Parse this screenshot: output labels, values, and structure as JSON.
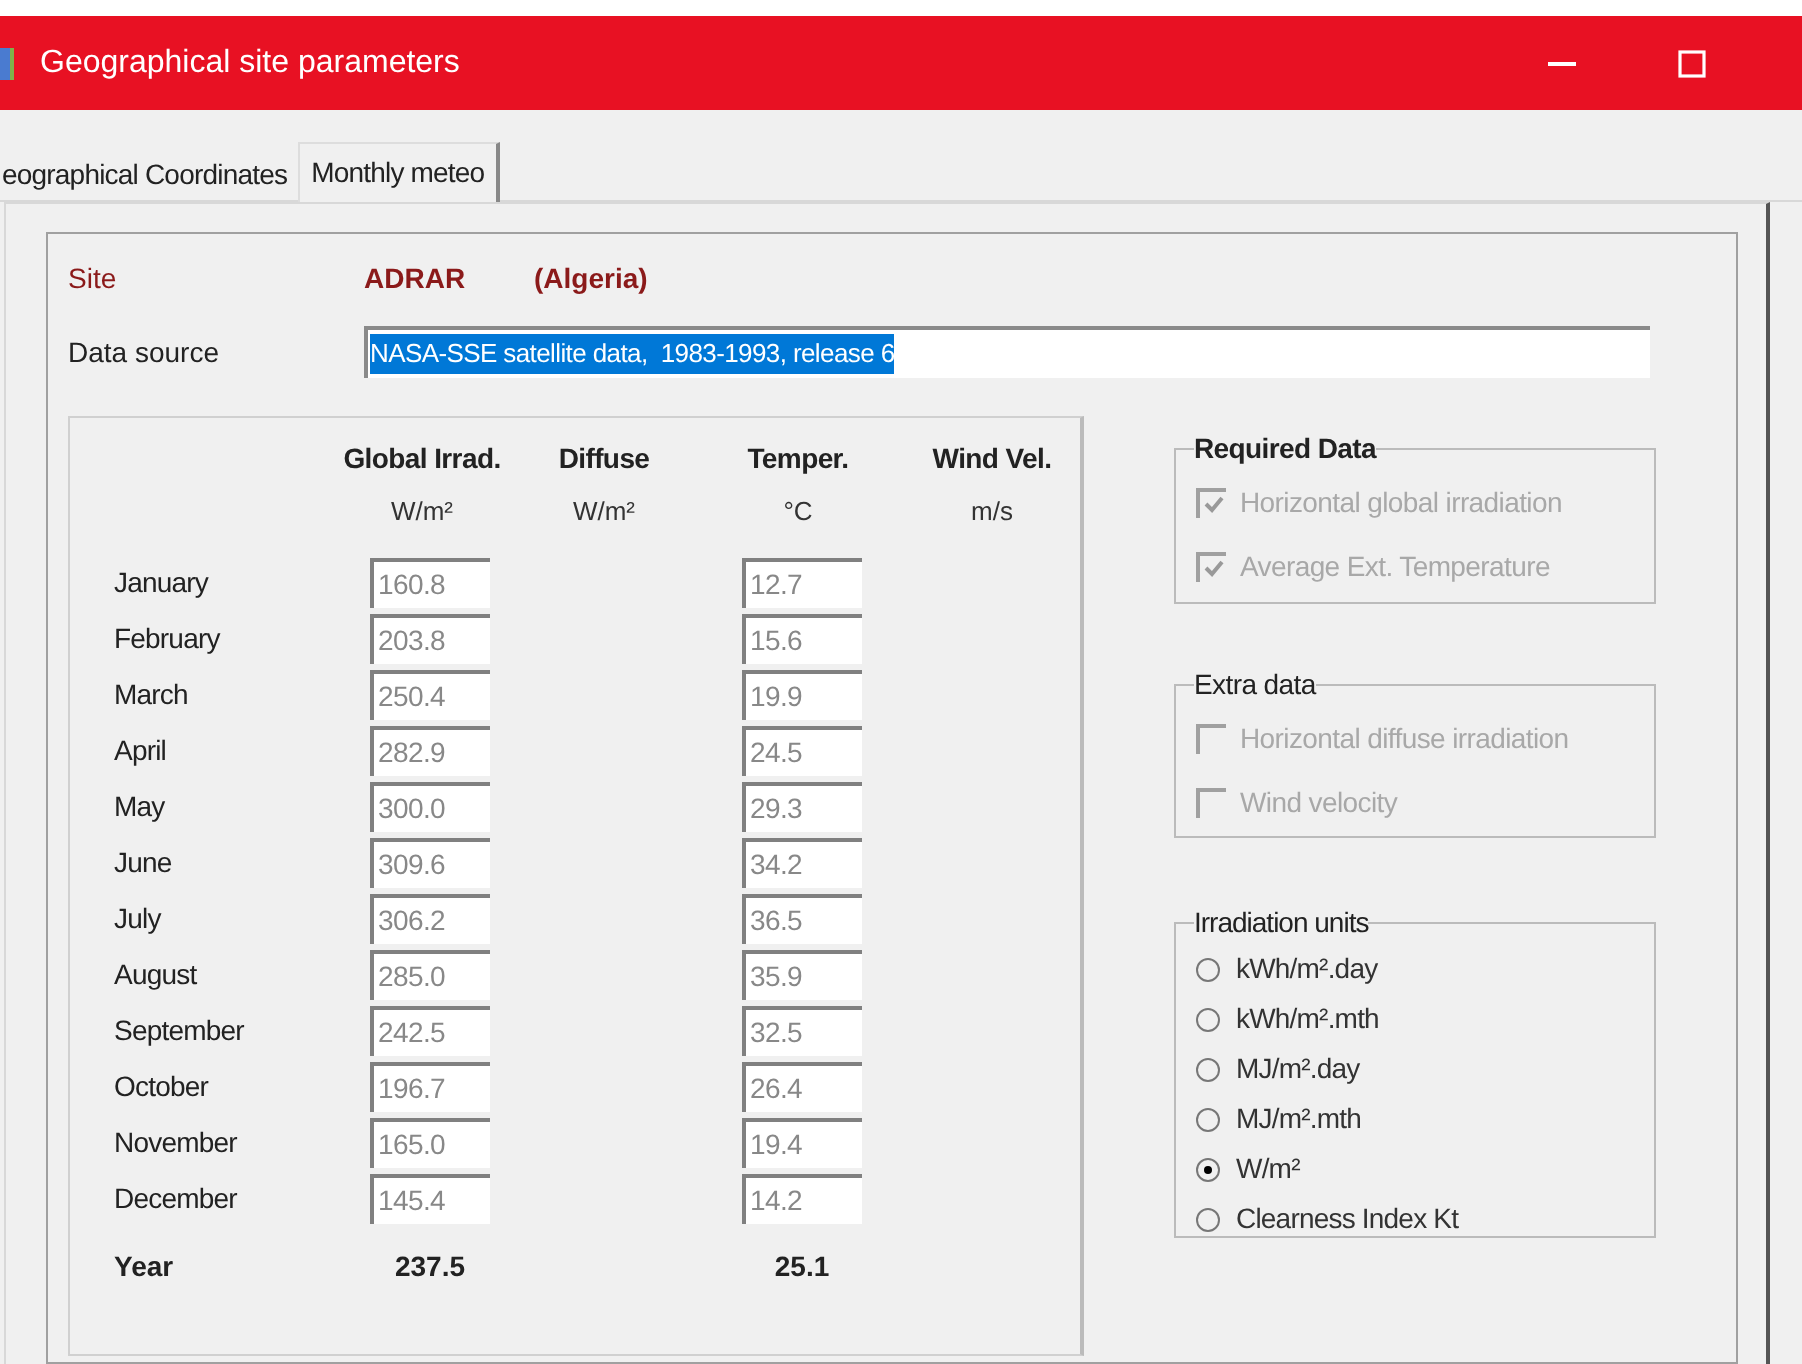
{
  "window": {
    "title": "Geographical site parameters"
  },
  "tabs": [
    {
      "label": "eographical Coordinates",
      "selected": false
    },
    {
      "label": "Monthly meteo",
      "selected": true
    }
  ],
  "site": {
    "label": "Site",
    "name": "ADRAR",
    "country": "(Algeria)"
  },
  "data_source": {
    "label": "Data source",
    "value": "NASA-SSE satellite data,  1983-1993, release 6",
    "selected": true
  },
  "table": {
    "columns": [
      {
        "title": "Global Irrad.",
        "unit": "W/m²"
      },
      {
        "title": "Diffuse",
        "unit": "W/m²"
      },
      {
        "title": "Temper.",
        "unit": "°C"
      },
      {
        "title": "Wind Vel.",
        "unit": "m/s"
      }
    ],
    "rows": [
      {
        "month": "January",
        "global": "160.8",
        "temp": "12.7"
      },
      {
        "month": "February",
        "global": "203.8",
        "temp": "15.6"
      },
      {
        "month": "March",
        "global": "250.4",
        "temp": "19.9"
      },
      {
        "month": "April",
        "global": "282.9",
        "temp": "24.5"
      },
      {
        "month": "May",
        "global": "300.0",
        "temp": "29.3"
      },
      {
        "month": "June",
        "global": "309.6",
        "temp": "34.2"
      },
      {
        "month": "July",
        "global": "306.2",
        "temp": "36.5"
      },
      {
        "month": "August",
        "global": "285.0",
        "temp": "35.9"
      },
      {
        "month": "September",
        "global": "242.5",
        "temp": "32.5"
      },
      {
        "month": "October",
        "global": "196.7",
        "temp": "26.4"
      },
      {
        "month": "November",
        "global": "165.0",
        "temp": "19.4"
      },
      {
        "month": "December",
        "global": "145.4",
        "temp": "14.2"
      }
    ],
    "year": {
      "label": "Year",
      "global": "237.5",
      "temp": "25.1"
    }
  },
  "required_data": {
    "title": "Required Data",
    "items": [
      {
        "label": "Horizontal global irradiation",
        "checked": true,
        "disabled": true
      },
      {
        "label": "Average Ext. Temperature",
        "checked": true,
        "disabled": true
      }
    ]
  },
  "extra_data": {
    "title": "Extra data",
    "items": [
      {
        "label": "Horizontal diffuse irradiation",
        "checked": false,
        "disabled": true
      },
      {
        "label": "Wind velocity",
        "checked": false,
        "disabled": true
      }
    ]
  },
  "irradiation_units": {
    "title": "Irradiation units",
    "options": [
      {
        "label": "kWh/m².day",
        "selected": false
      },
      {
        "label": "kWh/m².mth",
        "selected": false
      },
      {
        "label": "MJ/m².day",
        "selected": false
      },
      {
        "label": "MJ/m².mth",
        "selected": false
      },
      {
        "label": "W/m²",
        "selected": true
      },
      {
        "label": "Clearness Index Kt",
        "selected": false
      }
    ]
  }
}
